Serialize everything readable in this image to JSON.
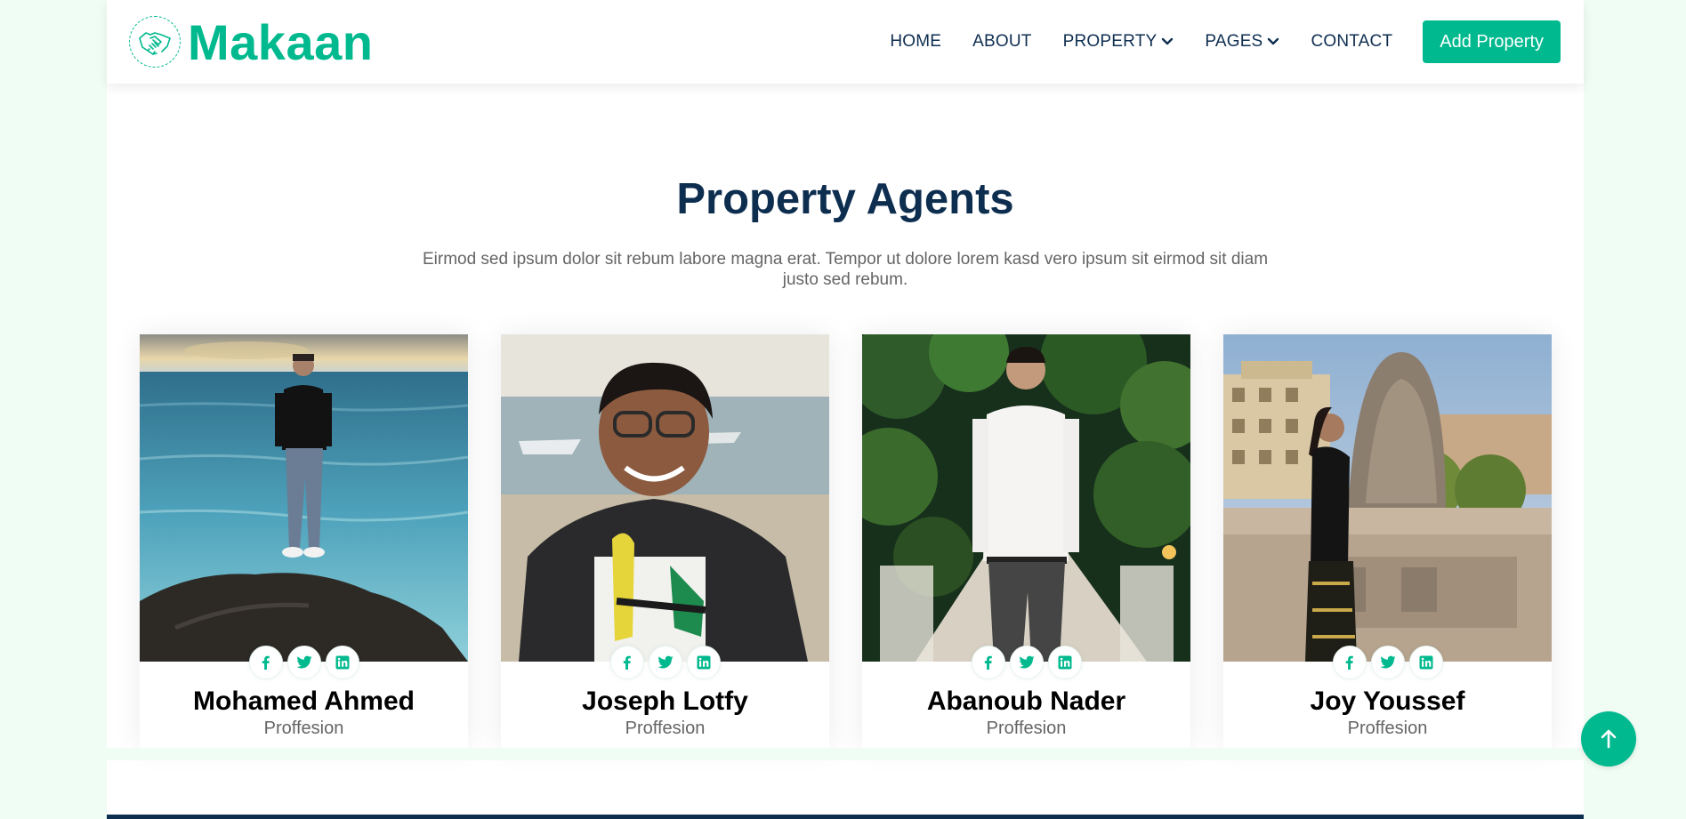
{
  "brand": {
    "name": "Makaan",
    "icon": "handshake-icon"
  },
  "nav": {
    "items": [
      {
        "label": "HOME",
        "dropdown": false
      },
      {
        "label": "ABOUT",
        "dropdown": false
      },
      {
        "label": "PROPERTY",
        "dropdown": true
      },
      {
        "label": "PAGES",
        "dropdown": true
      },
      {
        "label": "CONTACT",
        "dropdown": false
      }
    ],
    "cta_label": "Add Property"
  },
  "section": {
    "title": "Property Agents",
    "subtitle": "Eirmod sed ipsum dolor sit rebum labore magna erat. Tempor ut dolore lorem kasd vero ipsum sit eirmod sit diam justo sed rebum."
  },
  "agents": [
    {
      "name": "Mohamed Ahmed",
      "role": "Proffesion"
    },
    {
      "name": "Joseph Lotfy",
      "role": "Proffesion"
    },
    {
      "name": "Abanoub Nader",
      "role": "Proffesion"
    },
    {
      "name": "Joy Youssef",
      "role": "Proffesion"
    }
  ],
  "social_icons": [
    "facebook-icon",
    "twitter-icon",
    "linkedin-icon"
  ],
  "colors": {
    "primary": "#00b98e",
    "dark": "#0e2e50",
    "bg": "#effdf5",
    "muted": "#666565"
  },
  "back_to_top_icon": "arrow-up-icon"
}
